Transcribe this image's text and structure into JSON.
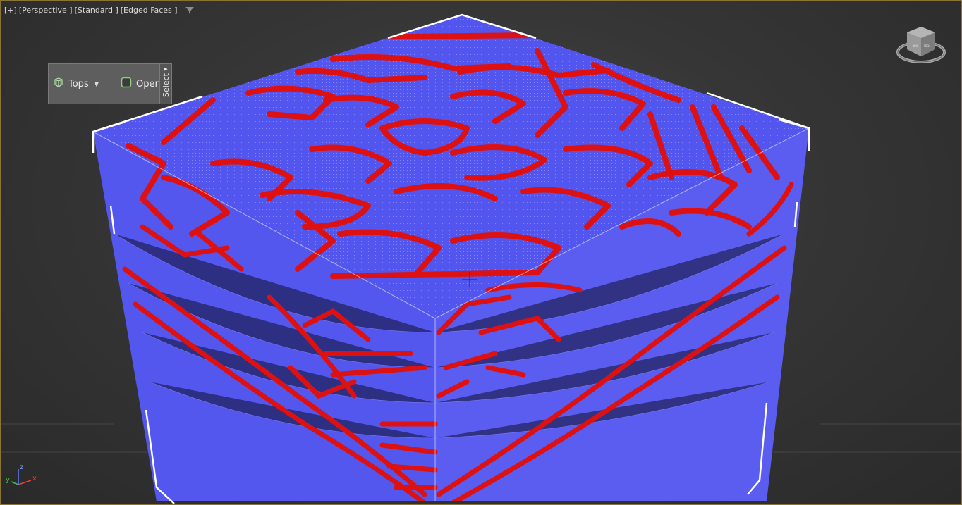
{
  "viewport": {
    "label": {
      "plus": "[+]",
      "view": "[Perspective ]",
      "shading": "[Standard ]",
      "style": "[Edged Faces ]"
    },
    "filter_icon": "filter-icon",
    "border_color": "#8a7436"
  },
  "ribbon": {
    "tops_label": "Tops",
    "open_label": "Open",
    "select_label": "Select",
    "tops_icon": "cube-wireframe-icon",
    "open_icon": "open-edge-icon"
  },
  "scene": {
    "object": "voxel-cube",
    "face_color": "#5457ee",
    "pattern_color": "#dd1111",
    "edge_color": "#ffffff"
  },
  "viewcube": {
    "icon": "viewcube-icon"
  },
  "axis": {
    "x": "x",
    "y": "y",
    "z": "z",
    "x_color": "#e84040",
    "y_color": "#40c040",
    "z_color": "#5a7bff"
  }
}
